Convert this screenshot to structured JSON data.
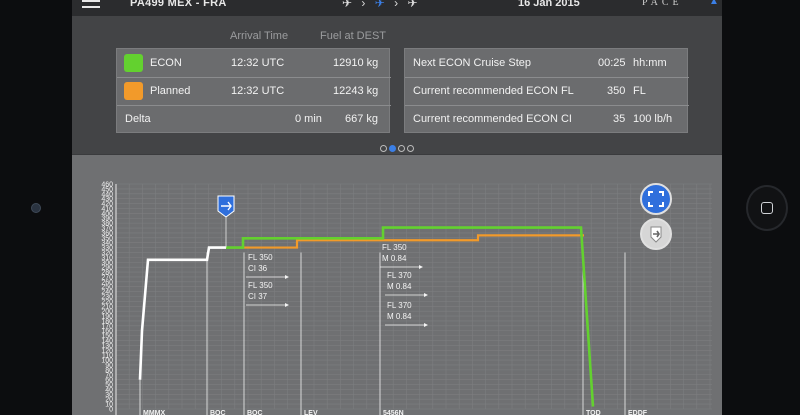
{
  "topbar": {
    "flight": "PA499 MEX - FRA",
    "date": "16 Jan 2015",
    "brand": "PACE",
    "phase_arrow": "›"
  },
  "summary": {
    "headers": {
      "arrival": "Arrival Time",
      "fuel": "Fuel at DEST"
    },
    "rows": [
      {
        "label": "ECON",
        "arrival": "12:32 UTC",
        "fuel": "12910 kg",
        "color": "#63d12f"
      },
      {
        "label": "Planned",
        "arrival": "12:32 UTC",
        "fuel": "12243 kg",
        "color": "#f29a2a"
      },
      {
        "label": "Delta",
        "arrival": "0 min",
        "fuel": "667 kg"
      }
    ]
  },
  "recommendations": [
    {
      "label": "Next ECON Cruise Step",
      "value": "00:25",
      "unit": "hh:mm"
    },
    {
      "label": "Current recommended ECON FL",
      "value": "350",
      "unit": "FL"
    },
    {
      "label": "Current recommended ECON CI",
      "value": "35",
      "unit": "100 lb/h"
    }
  ],
  "pager": {
    "count": 4,
    "active": 1
  },
  "chart_data": {
    "type": "line",
    "y_ticks": [
      0,
      10,
      20,
      30,
      40,
      50,
      60,
      70,
      80,
      90,
      100,
      110,
      120,
      130,
      140,
      150,
      160,
      170,
      180,
      190,
      200,
      210,
      220,
      230,
      240,
      250,
      260,
      270,
      280,
      290,
      300,
      310,
      320,
      330,
      340,
      350,
      360,
      370,
      380,
      390,
      400,
      410,
      420,
      430,
      440,
      450,
      460
    ],
    "ylim": [
      0,
      460
    ],
    "flown_color": "#ffffff",
    "econ_color": "#63d12f",
    "planned_color": "#f29a2a",
    "waypoints": [
      "MMMX",
      "BOC",
      "BOC",
      "LEV",
      "5456N",
      "TOD",
      "EDDF"
    ],
    "annotations": [
      {
        "lines": [
          "FL 350",
          "CI 36"
        ]
      },
      {
        "lines": [
          "FL 350",
          "CI 37"
        ]
      },
      {
        "lines": [
          "FL 350",
          "M 0.84"
        ]
      },
      {
        "lines": [
          "FL 370",
          "M 0.84"
        ]
      },
      {
        "lines": [
          "FL 370",
          "M 0.84"
        ]
      }
    ]
  }
}
